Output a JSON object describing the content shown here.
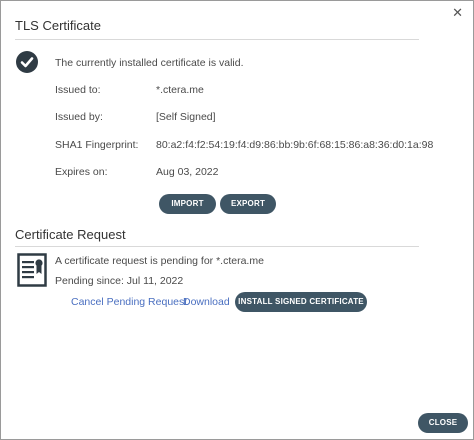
{
  "close_glyph": "✕",
  "tls": {
    "title": "TLS Certificate",
    "status": "The currently installed certificate is valid.",
    "fields": [
      {
        "label": "Issued to:",
        "value": "*.ctera.me"
      },
      {
        "label": "Issued by:",
        "value": "[Self Signed]"
      },
      {
        "label": "SHA1 Fingerprint:",
        "value": "80:a2:f4:f2:54:19:f4:d9:86:bb:9b:6f:68:15:86:a8:36:d0:1a:98"
      },
      {
        "label": "Expires on:",
        "value": "Aug 03, 2022"
      }
    ],
    "import_label": "IMPORT",
    "export_label": "EXPORT"
  },
  "request": {
    "title": "Certificate Request",
    "pending_text": "A certificate request is pending for *.ctera.me",
    "pending_since": "Pending since: Jul 11, 2022",
    "cancel_label": "Cancel Pending Request",
    "download_label": "Download",
    "install_label": "INSTALL SIGNED CERTIFICATE"
  },
  "footer": {
    "close_label": "CLOSE"
  },
  "colors": {
    "button_bg": "#3f5665",
    "link": "#4a6fc0",
    "divider": "#d9d9d9"
  }
}
